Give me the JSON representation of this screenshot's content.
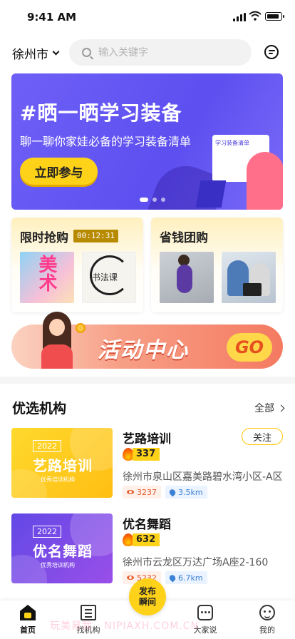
{
  "status_bar": {
    "time": "9:41 AM"
  },
  "header": {
    "city": "徐州市",
    "search_placeholder": "输入关键字"
  },
  "banner": {
    "title": "#晒一晒学习装备",
    "subtitle": "聊一聊你家娃必备的学习装备清单",
    "cta": "立即参与",
    "board_text": "学习装备清单",
    "slides_total": 3,
    "slide_active": 1
  },
  "flash_sale": {
    "title": "限时抢购",
    "timer": "00:12:31",
    "items": [
      "美术",
      "书法课"
    ]
  },
  "group_buy": {
    "title": "省钱团购"
  },
  "activity": {
    "label": "活动中心",
    "go": "GO"
  },
  "section": {
    "title": "优选机构",
    "more": "全部"
  },
  "orgs": [
    {
      "cover_year": "2022",
      "cover_name": "艺路培训",
      "cover_tag": "优秀培训机构",
      "name": "艺路培训",
      "follow": "关注",
      "hot": "337",
      "address": "徐州市泉山区嘉美路碧水湾小区-A区",
      "views": "3237",
      "distance": "3.5km"
    },
    {
      "cover_year": "2022",
      "cover_name": "优名舞蹈",
      "cover_tag": "优秀培训机构",
      "name": "优名舞蹈",
      "hot": "632",
      "address": "徐州市云龙区万达广场A座2-160",
      "views": "5232",
      "distance": "6.7km"
    }
  ],
  "tabbar": {
    "home": "首页",
    "find": "找机构",
    "publish": "发布瞬间",
    "talk": "大家说",
    "me": "我的"
  },
  "watermark": "玩美易我 · NIPIAXH.COM.CN",
  "colors": {
    "accent": "#ffd21a",
    "banner_bg": "#5d4ff0",
    "timer_bg": "#b88a00"
  }
}
